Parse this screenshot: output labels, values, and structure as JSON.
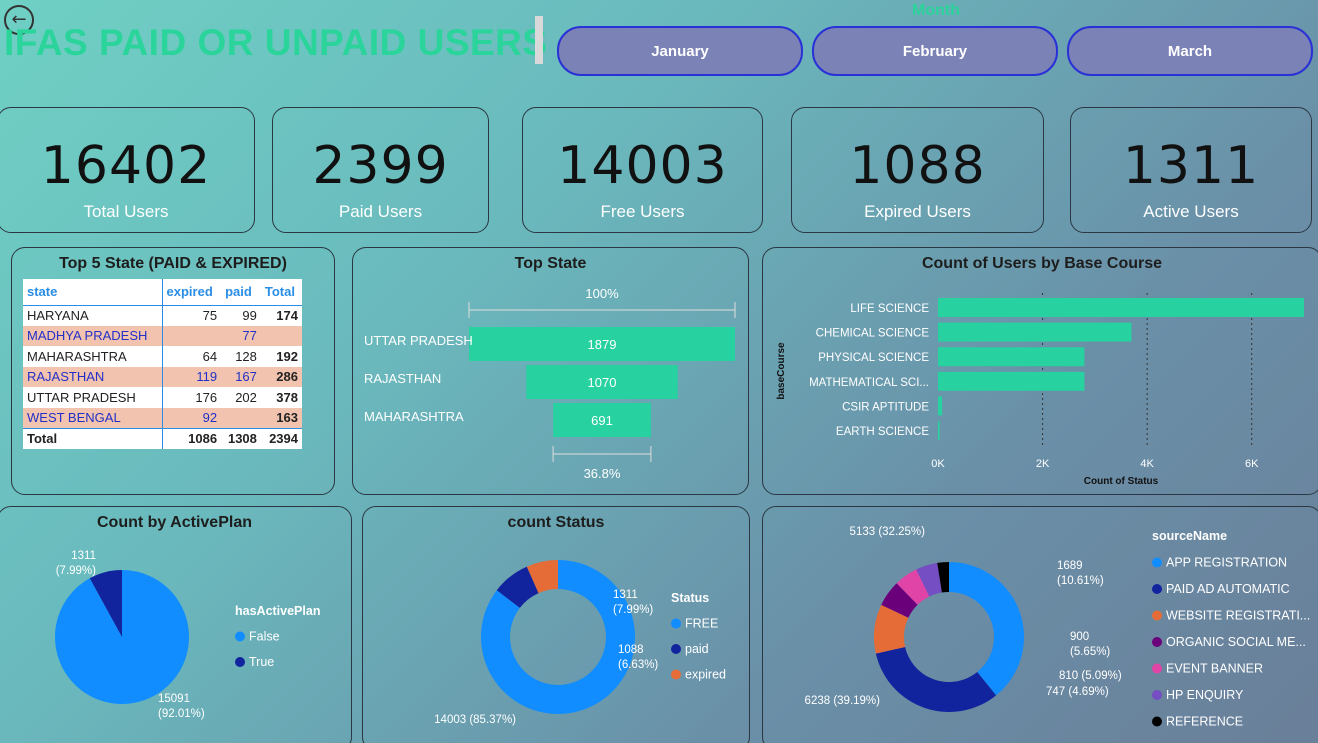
{
  "header": {
    "title": "IFAS PAID OR UNPAID USERS",
    "slicer_label": "Month",
    "months": [
      "January",
      "February",
      "March"
    ]
  },
  "kpis": [
    {
      "value": "16402",
      "label": "Total Users"
    },
    {
      "value": "2399",
      "label": "Paid Users"
    },
    {
      "value": "14003",
      "label": "Free Users"
    },
    {
      "value": "1088",
      "label": "Expired Users"
    },
    {
      "value": "1311",
      "label": "Active Users"
    }
  ],
  "state_table": {
    "title": "Top 5 State (PAID & EXPIRED)",
    "columns": [
      "state",
      "expired",
      "paid",
      "Total"
    ],
    "rows": [
      [
        "HARYANA",
        "75",
        "99",
        "174"
      ],
      [
        "MADHYA PRADESH",
        "",
        "77",
        ""
      ],
      [
        "MAHARASHTRA",
        "64",
        "128",
        "192"
      ],
      [
        "RAJASTHAN",
        "119",
        "167",
        "286"
      ],
      [
        "UTTAR PRADESH",
        "176",
        "202",
        "378"
      ],
      [
        "WEST BENGAL",
        "92",
        "",
        "163"
      ]
    ],
    "total": [
      "Total",
      "1086",
      "1308",
      "2394"
    ]
  },
  "chart_data": [
    {
      "type": "bar",
      "title": "Top State",
      "subtitle_top": "100%",
      "subtitle_bottom": "36.8%",
      "categories": [
        "UTTAR PRADESH",
        "RAJASTHAN",
        "MAHARASHTRA"
      ],
      "values": [
        1879,
        1070,
        691
      ]
    },
    {
      "type": "bar",
      "title": "Count of Users by Base Course",
      "xlabel": "Count of Status",
      "ylabel": "baseCourse",
      "categories": [
        "LIFE SCIENCE",
        "CHEMICAL SCIENCE",
        "PHYSICAL SCIENCE",
        "MATHEMATICAL SCI...",
        "CSIR APTITUDE",
        "EARTH SCIENCE"
      ],
      "values": [
        7000,
        3700,
        2800,
        2800,
        80,
        30
      ],
      "xticks": [
        "0K",
        "2K",
        "4K",
        "6K"
      ],
      "xlim": [
        0,
        7000
      ]
    },
    {
      "type": "pie",
      "title": "Count by ActivePlan",
      "legend_title": "hasActivePlan",
      "categories": [
        "False",
        "True"
      ],
      "values": [
        15091,
        1311
      ],
      "labels": [
        "15091\n(92.01%)",
        "1311\n(7.99%)"
      ],
      "colors": [
        "#118dff",
        "#12239e"
      ]
    },
    {
      "type": "pie",
      "title": "count Status",
      "legend_title": "Status",
      "categories": [
        "FREE",
        "paid",
        "expired"
      ],
      "values": [
        14003,
        1311,
        1088
      ],
      "labels": [
        "14003 (85.37%)",
        "1311\n(7.99%)",
        "1088\n(6.63%)"
      ],
      "colors": [
        "#118dff",
        "#12239e",
        "#e66c37"
      ]
    },
    {
      "type": "pie",
      "title": "",
      "legend_title": "sourceName",
      "categories": [
        "APP REGISTRATION",
        "PAID AD AUTOMATIC",
        "WEBSITE REGISTRATI...",
        "ORGANIC SOCIAL ME...",
        "EVENT BANNER",
        "HP ENQUIRY",
        "REFERENCE"
      ],
      "values": [
        6238,
        5133,
        1689,
        900,
        810,
        747,
        400
      ],
      "labels": [
        "6238 (39.19%)",
        "5133 (32.25%)",
        "1689\n(10.61%)",
        "900\n(5.65%)",
        "810 (5.09%)",
        "747 (4.69%)",
        ""
      ],
      "colors": [
        "#118dff",
        "#12239e",
        "#e66c37",
        "#6b007b",
        "#e044a7",
        "#744ec2",
        "#000000"
      ]
    }
  ]
}
